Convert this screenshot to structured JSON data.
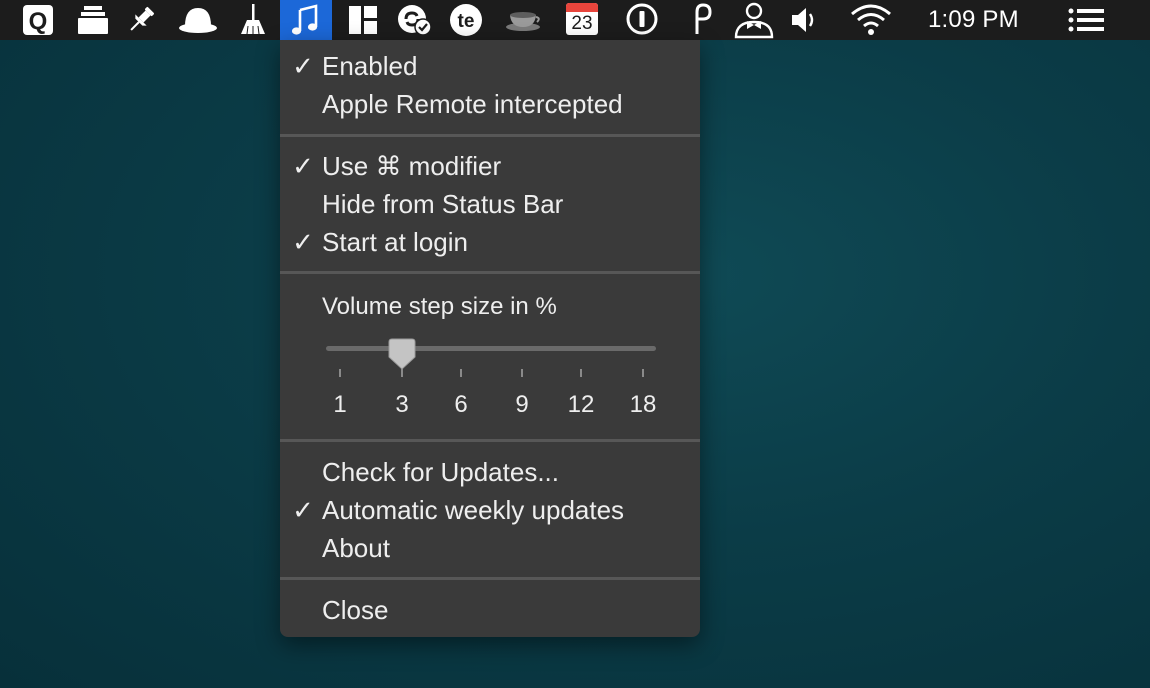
{
  "menubar": {
    "clock": "1:09 PM",
    "calendar_day": "23",
    "active_color": "#1c68d8",
    "icons": [
      "quicksilver-icon",
      "stack-icon",
      "pin-icon",
      "hat-icon",
      "broom-icon",
      "music-note-icon",
      "layout-icon",
      "sync-check-icon",
      "te-icon",
      "coffee-cup-icon",
      "calendar-icon",
      "info-circle-icon",
      "p-icon",
      "person-bowtie-icon",
      "volume-icon",
      "wifi-icon",
      "list-icon"
    ]
  },
  "menu": {
    "enabled": {
      "label": "Enabled",
      "checked": true
    },
    "remote": {
      "label": "Apple Remote intercepted",
      "checked": false
    },
    "use_modifier": {
      "label": "Use ⌘ modifier",
      "checked": true
    },
    "hide_status_bar": {
      "label": "Hide from Status Bar",
      "checked": false
    },
    "start_login": {
      "label": "Start at login",
      "checked": true
    },
    "volume_label": "Volume step size in %",
    "volume_value": 3,
    "volume_ticks": [
      "1",
      "3",
      "6",
      "9",
      "12",
      "18"
    ],
    "check_updates": {
      "label": "Check for Updates...",
      "checked": false
    },
    "weekly_updates": {
      "label": "Automatic weekly updates",
      "checked": true
    },
    "about": {
      "label": "About",
      "checked": false
    },
    "close": {
      "label": "Close",
      "checked": false
    },
    "checkmark": "✓"
  }
}
